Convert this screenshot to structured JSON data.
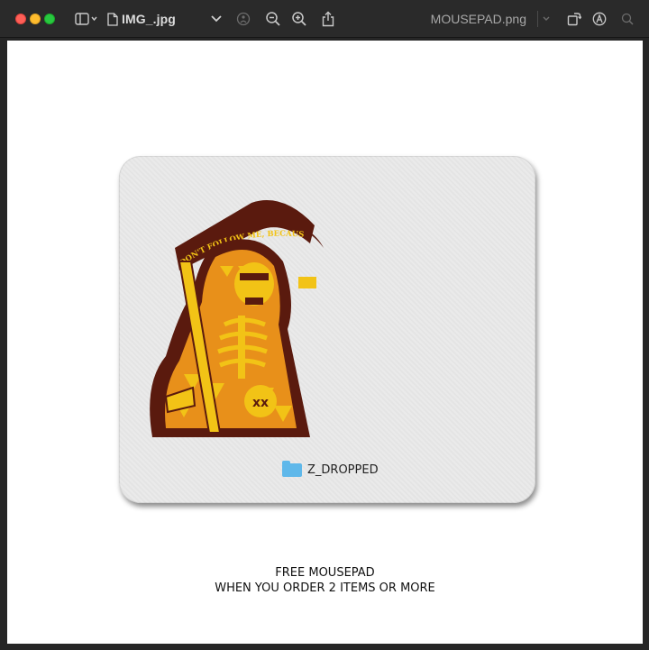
{
  "window": {
    "left_tab": {
      "label": "IMG_.jpg",
      "icon": "document-icon"
    },
    "right_tab": {
      "label": "MOUSEPAD.png"
    }
  },
  "toolbar": {
    "icons": [
      "sidebar-toggle-icon",
      "chevron-down-icon",
      "info-icon",
      "zoom-out-icon",
      "zoom-in-icon",
      "share-icon",
      "rotate-icon",
      "markup-icon",
      "search-icon"
    ]
  },
  "canvas": {
    "product_art_text": "DON'T FOLLOW ME, BECAUSE I DON'T KNOW WHERE I AM GOING...",
    "folder_tag": {
      "label": "Z_DROPPED",
      "color": "#5fb8ea"
    },
    "promo": {
      "line1": "FREE MOUSEPAD",
      "line2": "WHEN YOU ORDER 2 ITEMS OR MORE"
    }
  },
  "colors": {
    "titlebar": "#2a2a2a",
    "mousepad": "#e9e9e9",
    "art_dark": "#5a1a0e",
    "art_yellow": "#f2c316",
    "art_orange": "#e8901a"
  }
}
